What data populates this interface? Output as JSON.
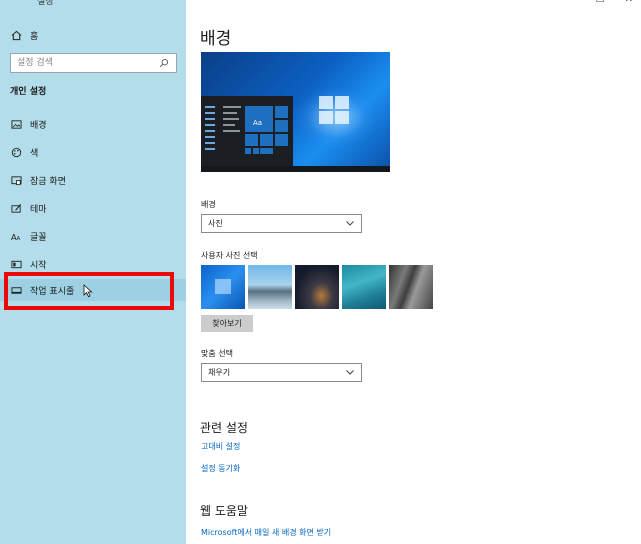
{
  "window": {
    "back_glyph": "←",
    "title": "설정",
    "minimize": "—",
    "maximize": "☐",
    "close": "✕"
  },
  "sidebar": {
    "home_label": "홈",
    "search_placeholder": "설정 검색",
    "section_title": "개인 설정",
    "items": [
      {
        "label": "배경",
        "icon": "picture-icon"
      },
      {
        "label": "색",
        "icon": "palette-icon"
      },
      {
        "label": "잠금 화면",
        "icon": "lock-screen-icon"
      },
      {
        "label": "테마",
        "icon": "theme-icon"
      },
      {
        "label": "글꼴",
        "icon": "font-icon"
      },
      {
        "label": "시작",
        "icon": "start-icon"
      },
      {
        "label": "작업 표시줄",
        "icon": "taskbar-icon",
        "active": true
      }
    ]
  },
  "main": {
    "page_title": "배경",
    "preview": {
      "tile_text": "Aa"
    },
    "background_label": "배경",
    "background_value": "사진",
    "choose_picture_label": "사용자 사진 선택",
    "browse_button": "찾아보기",
    "fit_label": "맞춤 선택",
    "fit_value": "채우기",
    "related_title": "관련 설정",
    "related_links": [
      "고대비 설정",
      "설정 동기화"
    ],
    "help_title": "웹 도움말",
    "help_links": [
      "Microsoft에서 매일 새 배경 화면 받기"
    ]
  },
  "colors": {
    "sidebar_bg": "#b3ddea",
    "accent": "#0067c0",
    "highlight": "#ea0a0a"
  }
}
